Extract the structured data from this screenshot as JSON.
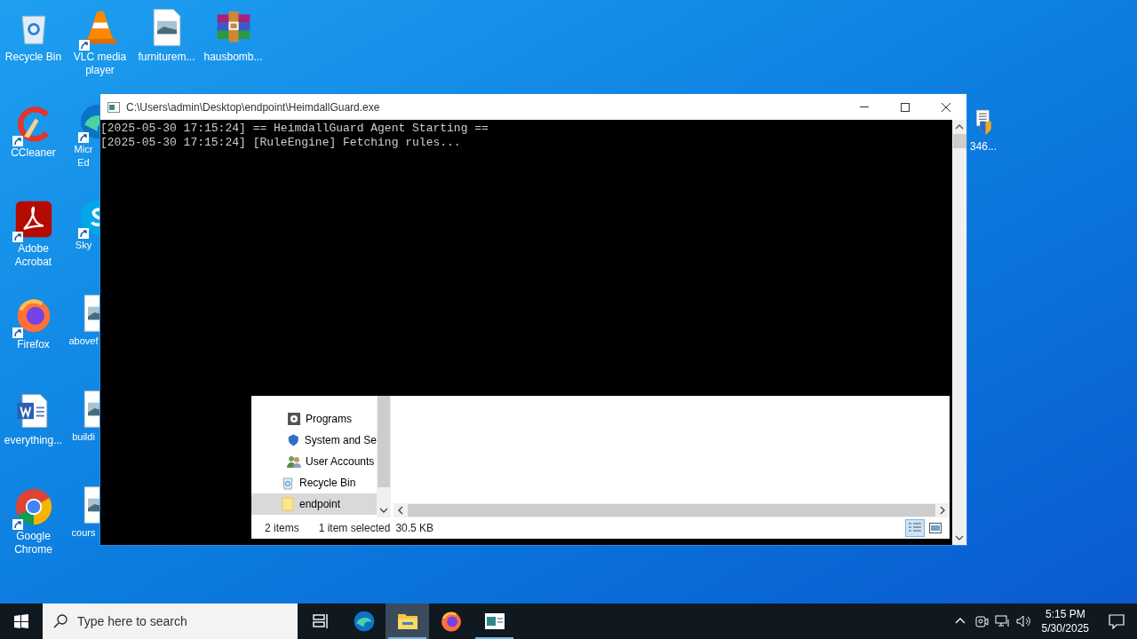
{
  "desktop": {
    "columns": [
      [
        {
          "label": "Recycle Bin",
          "kind": "recycle"
        },
        {
          "label": "CCleaner",
          "kind": "ccleaner"
        },
        {
          "label": "Adobe Acrobat",
          "kind": "acrobat"
        },
        {
          "label": "Firefox",
          "kind": "firefox"
        },
        {
          "label": "everything...",
          "kind": "word"
        },
        {
          "label": "Google Chrome",
          "kind": "chrome"
        }
      ],
      [
        {
          "label": "VLC media player",
          "kind": "vlc"
        },
        {
          "label": "Micr Ed",
          "kind": "edge"
        },
        {
          "label": "Sky",
          "kind": "skype"
        },
        {
          "label": "abovef",
          "kind": "image"
        },
        {
          "label": "buildi",
          "kind": "image"
        },
        {
          "label": "cours",
          "kind": "image"
        }
      ],
      [
        {
          "label": "furniturem...",
          "kind": "image"
        }
      ],
      [
        {
          "label": "hausbomb...",
          "kind": "archive"
        }
      ]
    ],
    "right_icon": {
      "label": "346...",
      "kind": "shielddoc"
    }
  },
  "console": {
    "title": "C:\\Users\\admin\\Desktop\\endpoint\\HeimdallGuard.exe",
    "lines": [
      "[2025-05-30 17:15:24] == HeimdallGuard Agent Starting ==",
      "[2025-05-30 17:15:24] [RuleEngine] Fetching rules..."
    ]
  },
  "explorer": {
    "nav_items": [
      {
        "label": "Programs",
        "kind": "programs",
        "indented": true,
        "selected": false
      },
      {
        "label": "System and Se",
        "kind": "system",
        "indented": true,
        "selected": false
      },
      {
        "label": "User Accounts",
        "kind": "users",
        "indented": true,
        "selected": false
      },
      {
        "label": "Recycle Bin",
        "kind": "recycle",
        "indented": false,
        "selected": false
      },
      {
        "label": "endpoint",
        "kind": "folder",
        "indented": false,
        "selected": true
      }
    ],
    "status": {
      "items": "2 items",
      "selection": "1 item selected",
      "size": "30.5 KB"
    }
  },
  "taskbar": {
    "search_placeholder": "Type here to search",
    "apps": [
      {
        "kind": "taskview",
        "open": false,
        "selected": false
      },
      {
        "kind": "edge",
        "open": false,
        "selected": false
      },
      {
        "kind": "explorer",
        "open": true,
        "selected": true
      },
      {
        "kind": "firefox",
        "open": false,
        "selected": false
      },
      {
        "kind": "console",
        "open": true,
        "selected": false
      }
    ],
    "time": "5:15 PM",
    "date": "5/30/2025"
  }
}
